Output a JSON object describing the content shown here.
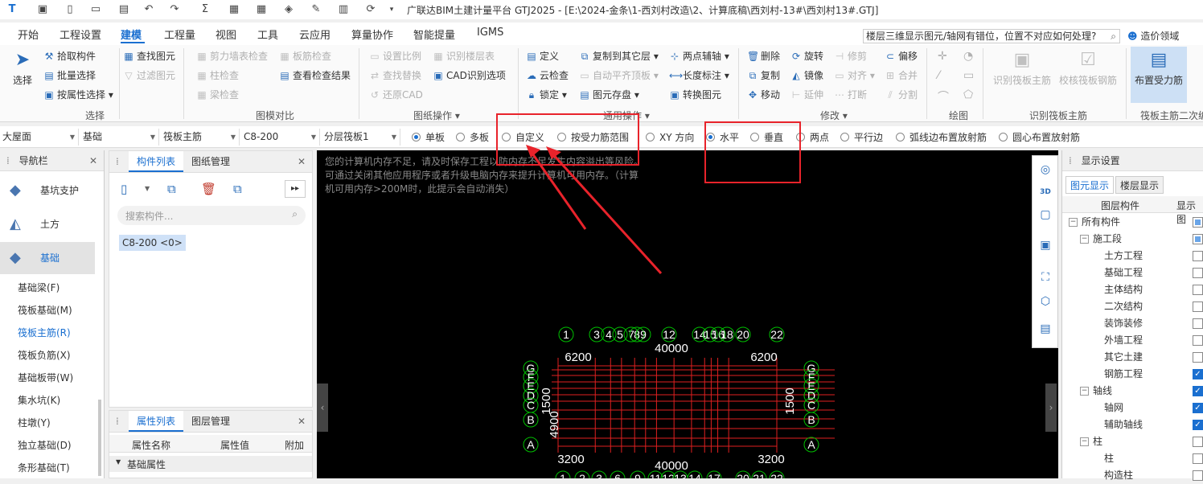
{
  "app": {
    "title": "广联达BIM土建计量平台 GTJ2025 - [E:\\2024-金条\\1-西刘村改造\\2、计算底稿\\西刘村-13#\\西刘村13#.GTJ]"
  },
  "menu": {
    "tabs": [
      "开始",
      "工程设置",
      "建模",
      "工程量",
      "视图",
      "工具",
      "云应用",
      "算量协作",
      "智能提量",
      "IGMS"
    ],
    "active": "建模",
    "help_search": "楼层三维显示图元/轴网有错位，位置不对应如何处理?",
    "user": "造价领域"
  },
  "ribbon": {
    "select_group": {
      "big": "选择",
      "items": [
        "拾取构件",
        "批量选择",
        "按属性选择"
      ],
      "label": "选择"
    },
    "compare_group": {
      "items": [
        "剪力墙表检查",
        "板筋检查",
        "柱检查",
        "查看检查结果",
        "梁检查"
      ],
      "label": "图模对比"
    },
    "find_group": {
      "items": [
        "查找图元",
        "过滤图元"
      ]
    },
    "drawing_group": {
      "items": [
        "设置比例",
        "识别楼层表",
        "查找替换",
        "CAD识别选项",
        "还原CAD"
      ],
      "label": "图纸操作"
    },
    "general_group": {
      "items": [
        "定义",
        "复制到其它层",
        "两点辅轴",
        "云检查",
        "自动平齐顶板",
        "长度标注",
        "锁定",
        "图元存盘",
        "转换图元"
      ],
      "label": "通用操作"
    },
    "modify_group": {
      "items": [
        "删除",
        "旋转",
        "修剪",
        "偏移",
        "复制",
        "镜像",
        "对齐",
        "合并",
        "移动",
        "延伸",
        "打断",
        "分割"
      ],
      "label": "修改"
    },
    "draw_group": {
      "label": "绘图"
    },
    "identify_group": {
      "items": [
        "识别筏板主筋",
        "校核筏板钢筋"
      ],
      "label": "识别筏板主筋"
    },
    "secondary_group": {
      "items": [
        "布置受力筋"
      ],
      "label": "筏板主筋二次编"
    }
  },
  "optbar": {
    "dropdowns": [
      "大屋面",
      "基础",
      "筏板主筋",
      "C8-200",
      "分层筏板1"
    ],
    "radios": [
      {
        "label": "单板",
        "on": true
      },
      {
        "label": "多板",
        "on": false
      },
      {
        "label": "自定义",
        "on": false
      },
      {
        "label": "按受力筋范围",
        "on": false
      },
      {
        "label": "XY 方向",
        "on": false
      },
      {
        "label": "水平",
        "on": true
      },
      {
        "label": "垂直",
        "on": false
      },
      {
        "label": "两点",
        "on": false
      },
      {
        "label": "平行边",
        "on": false
      },
      {
        "label": "弧线边布置放射筋",
        "on": false
      },
      {
        "label": "圆心布置放射筋",
        "on": false
      }
    ]
  },
  "nav": {
    "title": "导航栏",
    "big_items": [
      "基坑支护",
      "土方",
      "基础"
    ],
    "active_big": "基础",
    "items": [
      "基础梁(F)",
      "筏板基础(M)",
      "筏板主筋(R)",
      "筏板负筋(X)",
      "基础板带(W)",
      "集水坑(K)",
      "柱墩(Y)",
      "独立基础(D)",
      "条形基础(T)"
    ],
    "active_item": "筏板主筋(R)"
  },
  "components": {
    "tabs": [
      "构件列表",
      "图纸管理"
    ],
    "search_placeholder": "搜索构件...",
    "items": [
      "C8-200 <0>"
    ]
  },
  "properties": {
    "tabs": [
      "属性列表",
      "图层管理"
    ],
    "headers": [
      "属性名称",
      "属性值",
      "附加"
    ],
    "section": "基础属性"
  },
  "canvas": {
    "message": "您的计算机内存不足，请及时保存工程以防内存不足发生内容溢出等风险。可通过关闭其他应用程序或者升级电脑内存来提升计算机可用内存。（计算机可用内存>200M时，此提示会自动消失）",
    "top_axes": [
      "1",
      "3",
      "4",
      "5",
      "7",
      "8",
      "9",
      "12",
      "14",
      "15",
      "16",
      "18",
      "20",
      "22"
    ],
    "row_axes": [
      "G",
      "F",
      "E",
      "D",
      "C",
      "B",
      "A"
    ],
    "bottom_axes": [
      "1",
      "2",
      "3",
      "6",
      "9",
      "11",
      "12",
      "13",
      "14",
      "17",
      "20",
      "21",
      "22"
    ],
    "top_dim": "40000",
    "bottom_dim": "40000",
    "top_span": "6200",
    "top_span_right": "6200",
    "bottom_span_left": "3200",
    "bottom_span_right": "3200",
    "left_dim": "4900",
    "side_dim": "1500"
  },
  "display": {
    "title": "显示设置",
    "tabs": [
      "图元显示",
      "楼层显示"
    ],
    "headers": [
      "图层构件",
      "显示图"
    ],
    "rows": [
      {
        "label": "所有构件",
        "level": 0,
        "exp": "−",
        "chk": "part"
      },
      {
        "label": "施工段",
        "level": 1,
        "exp": "−",
        "chk": "part"
      },
      {
        "label": "土方工程",
        "level": 2,
        "chk": "off"
      },
      {
        "label": "基础工程",
        "level": 2,
        "chk": "off"
      },
      {
        "label": "主体结构",
        "level": 2,
        "chk": "off"
      },
      {
        "label": "二次结构",
        "level": 2,
        "chk": "off"
      },
      {
        "label": "装饰装修",
        "level": 2,
        "chk": "off"
      },
      {
        "label": "外墙工程",
        "level": 2,
        "chk": "off"
      },
      {
        "label": "其它土建",
        "level": 2,
        "chk": "off"
      },
      {
        "label": "钢筋工程",
        "level": 2,
        "chk": "on"
      },
      {
        "label": "轴线",
        "level": 1,
        "exp": "−",
        "chk": "on"
      },
      {
        "label": "轴网",
        "level": 2,
        "chk": "on"
      },
      {
        "label": "辅助轴线",
        "level": 2,
        "chk": "on"
      },
      {
        "label": "柱",
        "level": 1,
        "exp": "−",
        "chk": "off"
      },
      {
        "label": "柱",
        "level": 2,
        "chk": "off"
      },
      {
        "label": "构造柱",
        "level": 2,
        "chk": "off"
      }
    ]
  },
  "colors": {
    "accent": "#1a6fd0",
    "annotation": "#e8232b",
    "axis_green": "#00c000",
    "grid_red": "#e02020"
  }
}
